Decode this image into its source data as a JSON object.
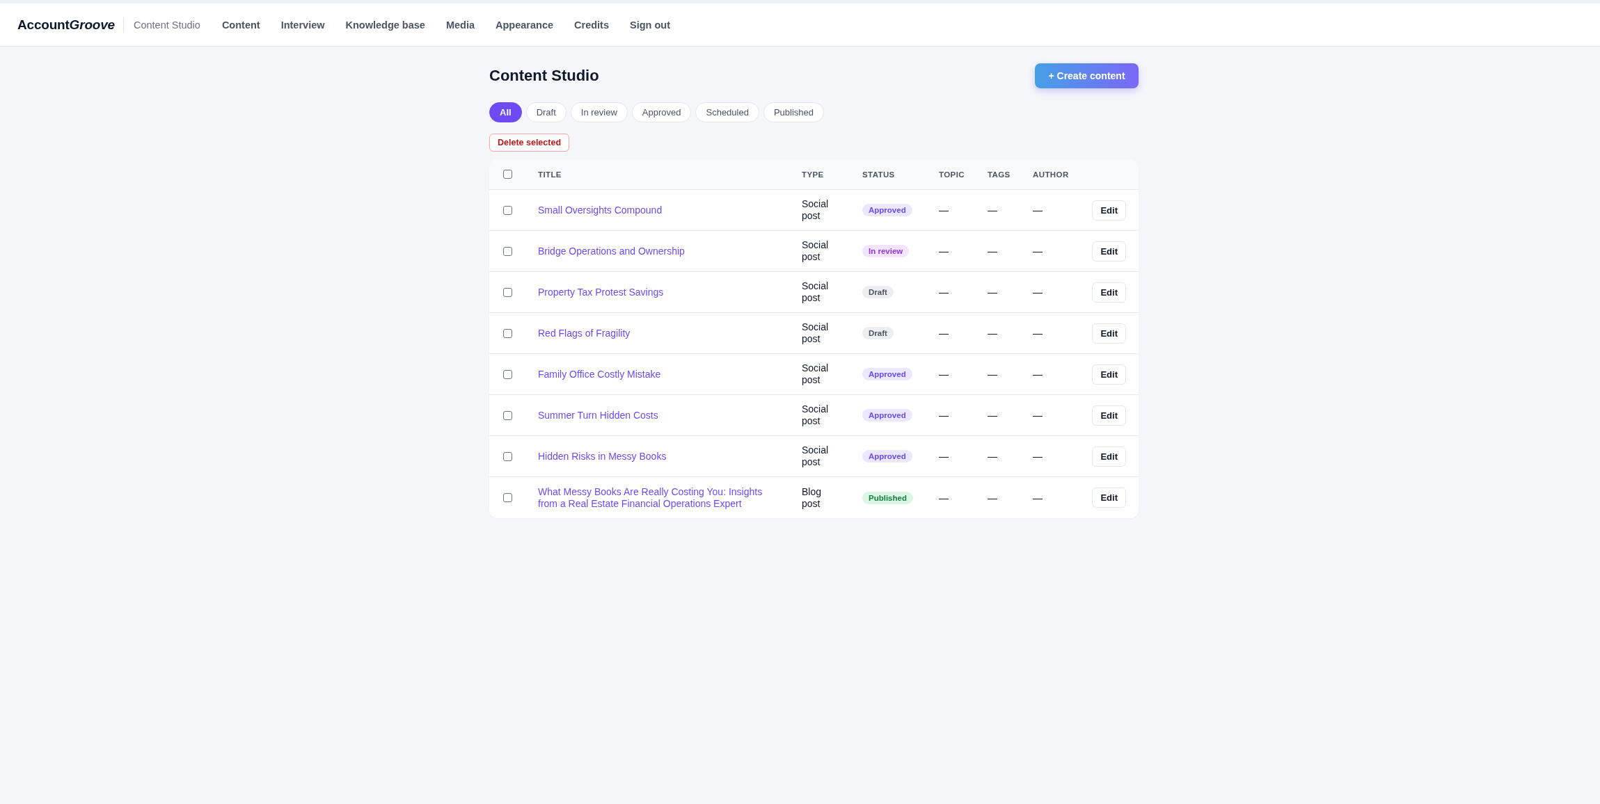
{
  "header": {
    "logo": {
      "text": "Account",
      "italic_text": "Groove"
    },
    "section": "Content Studio",
    "nav": [
      "Content",
      "Interview",
      "Knowledge base",
      "Media",
      "Appearance",
      "Credits",
      "Sign out"
    ]
  },
  "page": {
    "title": "Content Studio",
    "create_button": "+ Create content"
  },
  "filters": [
    {
      "label": "All",
      "selected": true
    },
    {
      "label": "Draft",
      "selected": false
    },
    {
      "label": "In review",
      "selected": false
    },
    {
      "label": "Approved",
      "selected": false
    },
    {
      "label": "Scheduled",
      "selected": false
    },
    {
      "label": "Published",
      "selected": false
    }
  ],
  "delete_button": "Delete selected",
  "table": {
    "select_all": {
      "checked": false
    },
    "columns": [
      "TITLE",
      "TYPE",
      "STATUS",
      "TOPIC",
      "TAGS",
      "AUTHOR"
    ],
    "rows": [
      {
        "checked": false,
        "title": "Small Oversights Compound",
        "type": "Social post",
        "status": {
          "label": "Approved",
          "kind": "approved"
        },
        "topic": "—",
        "tags": "—",
        "author": "—",
        "action": "Edit"
      },
      {
        "checked": false,
        "title": "Bridge Operations and Ownership",
        "type": "Social post",
        "status": {
          "label": "In review",
          "kind": "review"
        },
        "topic": "—",
        "tags": "—",
        "author": "—",
        "action": "Edit"
      },
      {
        "checked": false,
        "title": "Property Tax Protest Savings",
        "type": "Social post",
        "status": {
          "label": "Draft",
          "kind": "draft"
        },
        "topic": "—",
        "tags": "—",
        "author": "—",
        "action": "Edit"
      },
      {
        "checked": false,
        "title": "Red Flags of Fragility",
        "type": "Social post",
        "status": {
          "label": "Draft",
          "kind": "draft"
        },
        "topic": "—",
        "tags": "—",
        "author": "—",
        "action": "Edit"
      },
      {
        "checked": false,
        "title": "Family Office Costly Mistake",
        "type": "Social post",
        "status": {
          "label": "Approved",
          "kind": "approved"
        },
        "topic": "—",
        "tags": "—",
        "author": "—",
        "action": "Edit"
      },
      {
        "checked": false,
        "title": "Summer Turn Hidden Costs",
        "type": "Social post",
        "status": {
          "label": "Approved",
          "kind": "approved"
        },
        "topic": "—",
        "tags": "—",
        "author": "—",
        "action": "Edit"
      },
      {
        "checked": false,
        "title": "Hidden Risks in Messy Books",
        "type": "Social post",
        "status": {
          "label": "Approved",
          "kind": "approved"
        },
        "topic": "—",
        "tags": "—",
        "author": "—",
        "action": "Edit"
      },
      {
        "checked": false,
        "title": "What Messy Books Are Really Costing You: Insights from a Real Estate Financial Operations Expert",
        "type": "Blog post",
        "status": {
          "label": "Published",
          "kind": "published"
        },
        "topic": "—",
        "tags": "—",
        "author": "—",
        "action": "Edit"
      }
    ]
  }
}
